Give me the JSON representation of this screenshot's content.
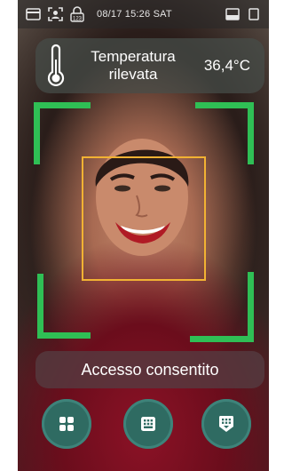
{
  "statusbar": {
    "icons": [
      "card-icon",
      "face-id-icon",
      "lock-icon"
    ],
    "lock_badge": "123",
    "datetime": "08/17 15:26",
    "weekday": "SAT",
    "right_icons": [
      "image-icon",
      "screen-icon"
    ]
  },
  "temperature": {
    "label": "Temperatura rilevata",
    "value": "36,4°C"
  },
  "access": {
    "message": "Accesso consentito"
  },
  "buttons": [
    {
      "name": "menu",
      "icon": "grid-four-icon"
    },
    {
      "name": "keypad",
      "icon": "keypad-icon"
    },
    {
      "name": "keypad-secure",
      "icon": "keypad-shield-icon"
    }
  ],
  "colors": {
    "frame_green": "#2fbf55",
    "face_box": "#f2b233",
    "button_teal": "#2f6b62"
  }
}
